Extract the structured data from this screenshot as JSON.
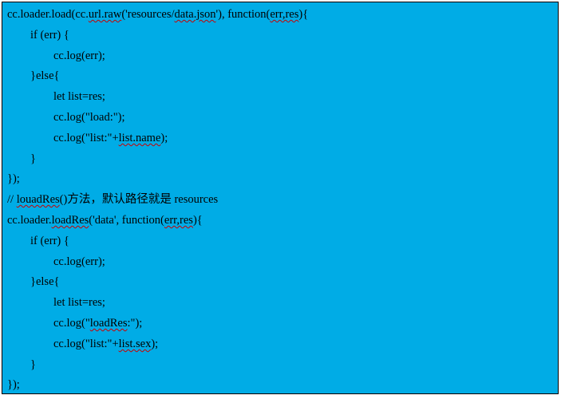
{
  "colors": {
    "background": "#00ace6",
    "border": "#000000",
    "text": "#000000",
    "wavy": "#cc0000"
  },
  "code": {
    "lines": [
      {
        "indent": 0,
        "parts": [
          {
            "t": "cc.loader.load(cc."
          },
          {
            "t": "url.raw",
            "err": true
          },
          {
            "t": "('resources/"
          },
          {
            "t": "data.json",
            "err": true
          },
          {
            "t": "'), function("
          },
          {
            "t": "err,res",
            "err": true
          },
          {
            "t": "){"
          }
        ]
      },
      {
        "indent": 1,
        "parts": [
          {
            "t": "if (err) {"
          }
        ]
      },
      {
        "indent": 2,
        "parts": [
          {
            "t": "cc.log(err);"
          }
        ]
      },
      {
        "indent": 1,
        "parts": [
          {
            "t": "}else{"
          }
        ]
      },
      {
        "indent": 2,
        "parts": [
          {
            "t": "let list=res;"
          }
        ]
      },
      {
        "indent": 2,
        "parts": [
          {
            "t": "cc.log(\"load:\");"
          }
        ]
      },
      {
        "indent": 2,
        "parts": [
          {
            "t": "cc.log(\"list:\"+"
          },
          {
            "t": "list.name",
            "err": true
          },
          {
            "t": ");"
          }
        ]
      },
      {
        "indent": 1,
        "parts": [
          {
            "t": "}"
          }
        ]
      },
      {
        "indent": 0,
        "parts": [
          {
            "t": "});"
          }
        ]
      },
      {
        "indent": 0,
        "parts": [
          {
            "t": "// "
          },
          {
            "t": "louadRes",
            "err": true
          },
          {
            "t": "()方法，默认路径就是 resources"
          }
        ]
      },
      {
        "indent": 0,
        "parts": [
          {
            "t": "cc.loader."
          },
          {
            "t": "loadRes",
            "err": true
          },
          {
            "t": "('data', function("
          },
          {
            "t": "err,res",
            "err": true
          },
          {
            "t": "){"
          }
        ]
      },
      {
        "indent": 1,
        "parts": [
          {
            "t": "if (err) {"
          }
        ]
      },
      {
        "indent": 2,
        "parts": [
          {
            "t": "cc.log(err);"
          }
        ]
      },
      {
        "indent": 1,
        "parts": [
          {
            "t": "}else{"
          }
        ]
      },
      {
        "indent": 2,
        "parts": [
          {
            "t": "let list=res;"
          }
        ]
      },
      {
        "indent": 2,
        "parts": [
          {
            "t": "cc.log(\""
          },
          {
            "t": "loadRes",
            "err": true
          },
          {
            "t": ":\");"
          }
        ]
      },
      {
        "indent": 2,
        "parts": [
          {
            "t": "cc.log(\"list:\"+"
          },
          {
            "t": "list.sex",
            "err": true
          },
          {
            "t": ");"
          }
        ]
      },
      {
        "indent": 1,
        "parts": [
          {
            "t": "}"
          }
        ]
      },
      {
        "indent": 0,
        "parts": [
          {
            "t": "});"
          }
        ]
      }
    ]
  }
}
